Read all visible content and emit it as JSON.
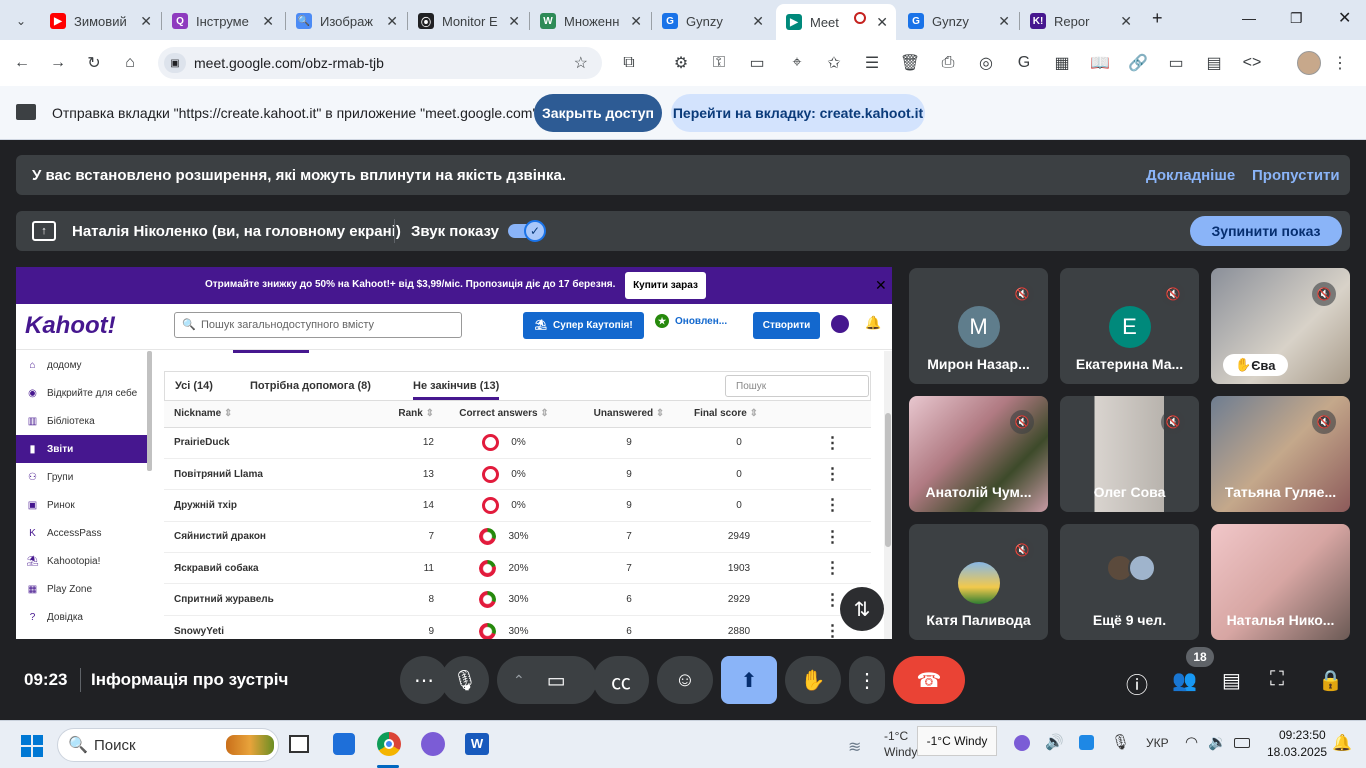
{
  "browser": {
    "tabs": [
      {
        "title": "Зимовий",
        "icon": "youtube-icon",
        "color": "#ff0000",
        "glyph": "▶"
      },
      {
        "title": "Інструме",
        "icon": "quizizz-icon",
        "color": "#8e3bbf",
        "glyph": "Q"
      },
      {
        "title": "Изображ",
        "icon": "search-icon",
        "color": "#4c8bf5",
        "glyph": "🔍"
      },
      {
        "title": "Monitor E",
        "icon": "monitor-icon",
        "color": "#202124",
        "glyph": "⦿"
      },
      {
        "title": "Множенн",
        "icon": "wordwall-icon",
        "color": "#2e8b57",
        "glyph": "W"
      },
      {
        "title": "Gynzy",
        "icon": "gynzy-icon",
        "color": "#1a73e8",
        "glyph": "G"
      },
      {
        "title": "Meet",
        "icon": "meet-icon",
        "color": "#00897b",
        "glyph": "▶",
        "active": true
      },
      {
        "title": "Gynzy",
        "icon": "gynzy-icon",
        "color": "#1a73e8",
        "glyph": "G"
      },
      {
        "title": "Repor",
        "icon": "kahoot-tab-icon",
        "color": "#46178f",
        "glyph": "K!"
      }
    ],
    "url": "meet.google.com/obz-rmab-tjb"
  },
  "castbar": {
    "message": "Отправка вкладки \"https://create.kahoot.it\" в приложение \"meet.google.com\"...",
    "stop_label": "Закрыть доступ",
    "goto_label": "Перейти на вкладку: create.kahoot.it"
  },
  "meet": {
    "ext_warning": "У вас встановлено розширення, які можуть вплинути на якість дзвінка.",
    "ext_more": "Докладніше",
    "ext_skip": "Пропустити",
    "presenter": "Наталія Ніколенко (ви, на головному екрані)",
    "sound_label": "Звук показу",
    "stop_share": "Зупинити показ",
    "time": "09:23",
    "meeting_info": "Інформація про зустріч",
    "participant_count": "18",
    "participants": [
      {
        "name": "Мирон Назар...",
        "initial": "M",
        "color": "#5f7d8c"
      },
      {
        "name": "Екатерина Ма...",
        "initial": "E",
        "color": "#00897b"
      },
      {
        "name": "Єва",
        "video": true
      },
      {
        "name": "Анатолій Чум...",
        "video": true
      },
      {
        "name": "Олег Сова",
        "video": true
      },
      {
        "name": "Татьяна Гуляе...",
        "video": true
      },
      {
        "name": "Катя Паливода",
        "video": false
      },
      {
        "name": "Ещё 9 чел.",
        "video": false
      },
      {
        "name": "Наталья Нико...",
        "video": true
      }
    ]
  },
  "kahoot": {
    "promo": "Отримайте знижку до 50% на Kahoot!+ від $3,99/міс. Пропозиція діє до 17 березня.",
    "promo_btn": "Купити зараз",
    "logo": "Kahoot!",
    "search_placeholder": "Пошук загальнодоступного вмісту",
    "btn_super": "Супер Каутопія!",
    "btn_updated": "Оновлен...",
    "btn_create": "Створити",
    "sidebar": [
      "додому",
      "Відкрийте для себе",
      "Бібліотека",
      "Звіти",
      "Групи",
      "Ринок",
      "AccessPass",
      "Kahootopia!",
      "Play Zone",
      "Довідка"
    ],
    "tabs": [
      "Усі (14)",
      "Потрібна допомога (8)",
      "Не закінчив (13)"
    ],
    "table_search": "Пошук",
    "columns": [
      "Nickname",
      "Rank",
      "Correct answers",
      "Unanswered",
      "Final score"
    ],
    "rows": [
      {
        "nickname": "PrairieDuck",
        "rank": "12",
        "correct": "0%",
        "pct": 0,
        "unanswered": "9",
        "score": "0"
      },
      {
        "nickname": "Повітряний Llama",
        "rank": "13",
        "correct": "0%",
        "pct": 0,
        "unanswered": "9",
        "score": "0"
      },
      {
        "nickname": "Дружній тхір",
        "rank": "14",
        "correct": "0%",
        "pct": 0,
        "unanswered": "9",
        "score": "0"
      },
      {
        "nickname": "Сяйнистий дракон",
        "rank": "7",
        "correct": "30%",
        "pct": 30,
        "unanswered": "7",
        "score": "2949"
      },
      {
        "nickname": "Яскравий собака",
        "rank": "11",
        "correct": "20%",
        "pct": 20,
        "unanswered": "7",
        "score": "1903"
      },
      {
        "nickname": "Спритний журавель",
        "rank": "8",
        "correct": "30%",
        "pct": 30,
        "unanswered": "6",
        "score": "2929"
      },
      {
        "nickname": "SnowyYeti",
        "rank": "9",
        "correct": "30%",
        "pct": 30,
        "unanswered": "6",
        "score": "2880"
      }
    ]
  },
  "taskbar": {
    "search": "Поиск",
    "weather_temp": "-1°C",
    "weather_label": "Windy",
    "weather_tooltip": "-1°C Windy",
    "lang": "УКР",
    "time": "09:23:50",
    "date": "18.03.2025"
  }
}
